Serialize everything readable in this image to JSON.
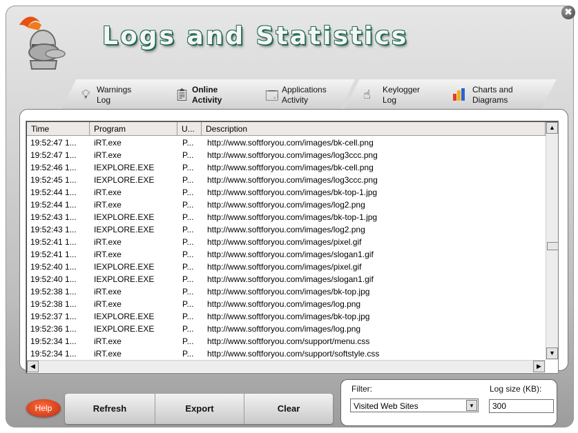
{
  "window": {
    "title": "Logs and Statistics",
    "close_glyph": "✖"
  },
  "tabs": [
    {
      "line1": "Warnings",
      "line2": "Log",
      "icon": "lightbulb-icon",
      "active": false
    },
    {
      "line1": "Online",
      "line2": "Activity",
      "icon": "clipboard-icon",
      "active": true
    },
    {
      "line1": "Applications",
      "line2": "Activity",
      "icon": "window-icon",
      "active": false
    },
    {
      "line1": "Keylogger",
      "line2": "Log",
      "icon": "keyboard-hand-icon",
      "active": false
    },
    {
      "line1": "Charts and",
      "line2": "Diagrams",
      "icon": "bar-chart-icon",
      "active": false
    }
  ],
  "table": {
    "columns": [
      "Time",
      "Program",
      "U...",
      "Description"
    ],
    "rows": [
      [
        "19:52:47 1...",
        "iRT.exe",
        "P...",
        "http://www.softforyou.com/images/bk-cell.png"
      ],
      [
        "19:52:47 1...",
        "iRT.exe",
        "P...",
        "http://www.softforyou.com/images/log3ccc.png"
      ],
      [
        "19:52:46 1...",
        "IEXPLORE.EXE",
        "P...",
        "http://www.softforyou.com/images/bk-cell.png"
      ],
      [
        "19:52:45 1...",
        "IEXPLORE.EXE",
        "P...",
        "http://www.softforyou.com/images/log3ccc.png"
      ],
      [
        "19:52:44 1...",
        "iRT.exe",
        "P...",
        "http://www.softforyou.com/images/bk-top-1.jpg"
      ],
      [
        "19:52:44 1...",
        "iRT.exe",
        "P...",
        "http://www.softforyou.com/images/log2.png"
      ],
      [
        "19:52:43 1...",
        "IEXPLORE.EXE",
        "P...",
        "http://www.softforyou.com/images/bk-top-1.jpg"
      ],
      [
        "19:52:43 1...",
        "IEXPLORE.EXE",
        "P...",
        "http://www.softforyou.com/images/log2.png"
      ],
      [
        "19:52:41 1...",
        "iRT.exe",
        "P...",
        "http://www.softforyou.com/images/pixel.gif"
      ],
      [
        "19:52:41 1...",
        "iRT.exe",
        "P...",
        "http://www.softforyou.com/images/slogan1.gif"
      ],
      [
        "19:52:40 1...",
        "IEXPLORE.EXE",
        "P...",
        "http://www.softforyou.com/images/pixel.gif"
      ],
      [
        "19:52:40 1...",
        "IEXPLORE.EXE",
        "P...",
        "http://www.softforyou.com/images/slogan1.gif"
      ],
      [
        "19:52:38 1...",
        "iRT.exe",
        "P...",
        "http://www.softforyou.com/images/bk-top.jpg"
      ],
      [
        "19:52:38 1...",
        "iRT.exe",
        "P...",
        "http://www.softforyou.com/images/log.png"
      ],
      [
        "19:52:37 1...",
        "IEXPLORE.EXE",
        "P...",
        "http://www.softforyou.com/images/bk-top.jpg"
      ],
      [
        "19:52:36 1...",
        "IEXPLORE.EXE",
        "P...",
        "http://www.softforyou.com/images/log.png"
      ],
      [
        "19:52:34 1...",
        "iRT.exe",
        "P...",
        "http://www.softforyou.com/support/menu.css"
      ],
      [
        "19:52:34 1...",
        "iRT.exe",
        "P...",
        "http://www.softforyou.com/support/softstyle.css"
      ]
    ]
  },
  "buttons": {
    "help": "Help",
    "refresh": "Refresh",
    "export": "Export",
    "clear": "Clear"
  },
  "filter": {
    "label": "Filter:",
    "selected": "Visited Web Sites"
  },
  "log_size": {
    "label": "Log size (KB):",
    "value": "300"
  },
  "colors": {
    "title_outline": "#1f6b52",
    "help_button": "#e2461d"
  }
}
